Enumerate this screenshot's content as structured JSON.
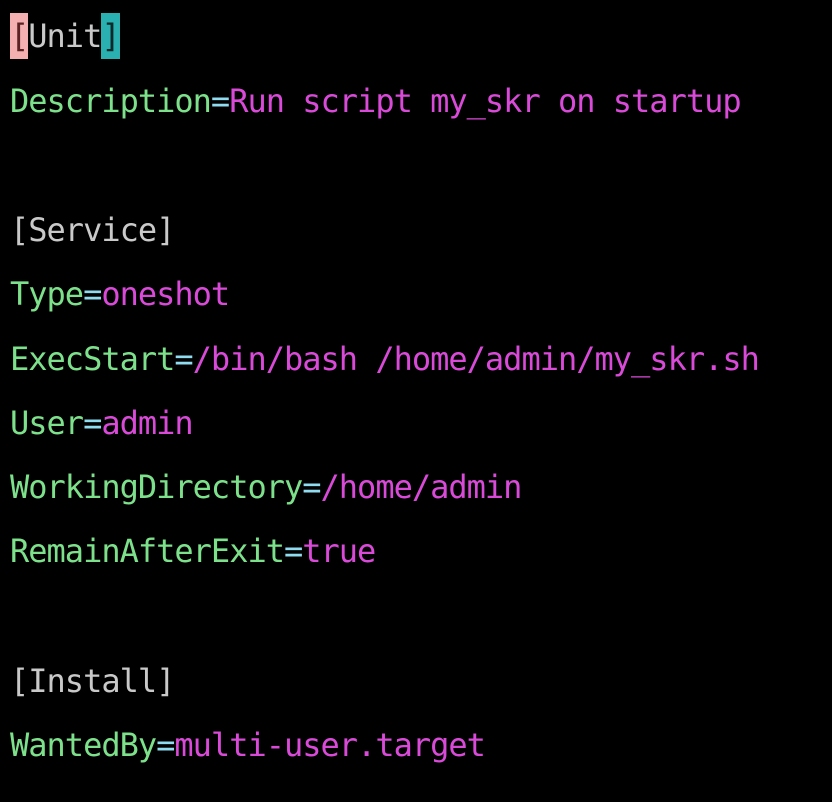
{
  "colors": {
    "background": "#000000",
    "section": "#c9c9c9",
    "key": "#7de08b",
    "equals": "#8fdcf0",
    "value": "#d94ad9",
    "bracket_highlight_open": "#f4b0b0",
    "bracket_highlight_close": "#2ab0b0"
  },
  "unit": {
    "open_bracket": "[",
    "name": "Unit",
    "close_bracket": "]",
    "description_key": "Description",
    "description_value": "Run script my_skr on startup"
  },
  "service": {
    "header": "[Service]",
    "type_key": "Type",
    "type_value": "oneshot",
    "execstart_key": "ExecStart",
    "execstart_value": "/bin/bash /home/admin/my_skr.sh",
    "user_key": "User",
    "user_value": "admin",
    "workdir_key": "WorkingDirectory",
    "workdir_value": "/home/admin",
    "remain_key": "RemainAfterExit",
    "remain_value": "true"
  },
  "install": {
    "header": "[Install]",
    "wantedby_key": "WantedBy",
    "wantedby_value": "multi-user.target"
  },
  "equals_sign": "="
}
